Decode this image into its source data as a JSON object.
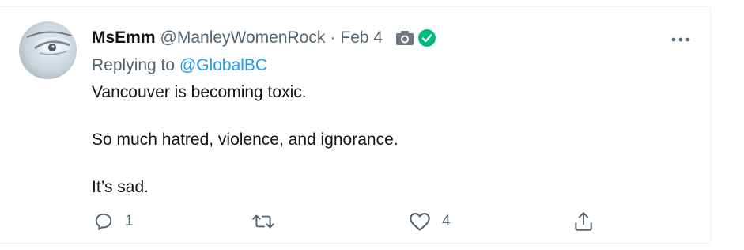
{
  "tweet": {
    "display_name": "MsEmm",
    "handle": "@ManleyWomenRock",
    "separator": "·",
    "date": "Feb 4",
    "replying_prefix": "Replying to ",
    "replying_to": "@GlobalBC",
    "text_lines": [
      "Vancouver is becoming toxic.",
      "So much hatred, violence, and ignorance.",
      "It’s sad."
    ],
    "icons": {
      "media": "camera-icon",
      "verified": "verified-check-icon",
      "more": "more-options-icon"
    },
    "actions": {
      "reply_count": "1",
      "retweet_count": "",
      "like_count": "4"
    },
    "colors": {
      "link": "#1d9bf0",
      "verified": "#00ba7c",
      "secondary_text": "#536471",
      "camera": "#6e7781"
    }
  }
}
